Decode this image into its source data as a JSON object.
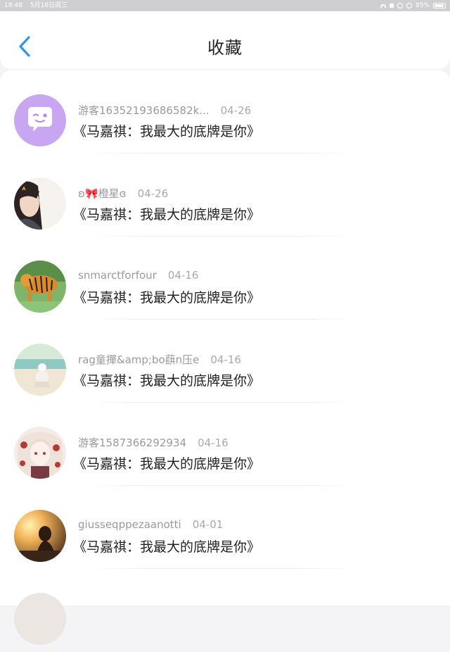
{
  "status_bar": {
    "time": "18:48",
    "date": "5月18日周三",
    "battery": "85%"
  },
  "header": {
    "title": "收藏",
    "back_icon": "chevron-left-icon"
  },
  "colors": {
    "accent": "#2f95e6",
    "avatar_purple": "#c9a6f2"
  },
  "favorites": [
    {
      "user": "游客16352193686582k...",
      "date": "04-26",
      "title": "《马嘉祺：我最大的底牌是你》",
      "avatar": "chat-bubble-avatar"
    },
    {
      "user": "ʚ🎀橙星ɞ",
      "date": "04-26",
      "title": "《马嘉祺：我最大的底牌是你》",
      "avatar": "girl-photo-avatar"
    },
    {
      "user": "snmarctforfour",
      "date": "04-16",
      "title": "《马嘉祺：我最大的底牌是你》",
      "avatar": "tiger-photo-avatar"
    },
    {
      "user": "rag童撣&amp;bo蕻n压e",
      "date": "04-16",
      "title": "《马嘉祺：我最大的底牌是你》",
      "avatar": "beach-photo-avatar"
    },
    {
      "user": "游客1587366292934",
      "date": "04-16",
      "title": "《马嘉祺：我最大的底牌是你》",
      "avatar": "anime-girl-avatar"
    },
    {
      "user": "giusseqppezaanotti",
      "date": "04-01",
      "title": "《马嘉祺：我最大的底牌是你》",
      "avatar": "sunset-photo-avatar"
    }
  ]
}
